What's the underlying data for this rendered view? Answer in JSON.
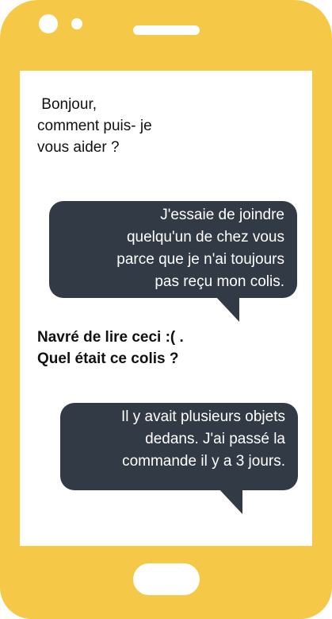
{
  "conversation": {
    "msg1": " Bonjour,\ncomment puis- je\nvous aider ?",
    "msg2": "J'essaie de joindre\nquelqu'un de chez vous\nparce que je n'ai toujours\npas reçu mon colis.",
    "msg3": "Navré de lire ceci :( .\nQuel était ce colis ?",
    "msg4": "Il y avait plusieurs objets\ndedans. J'ai passé la\ncommande il y a 3 jours."
  },
  "colors": {
    "phone_body": "#F5C947",
    "bubble": "#323A45",
    "screen": "#ffffff"
  }
}
